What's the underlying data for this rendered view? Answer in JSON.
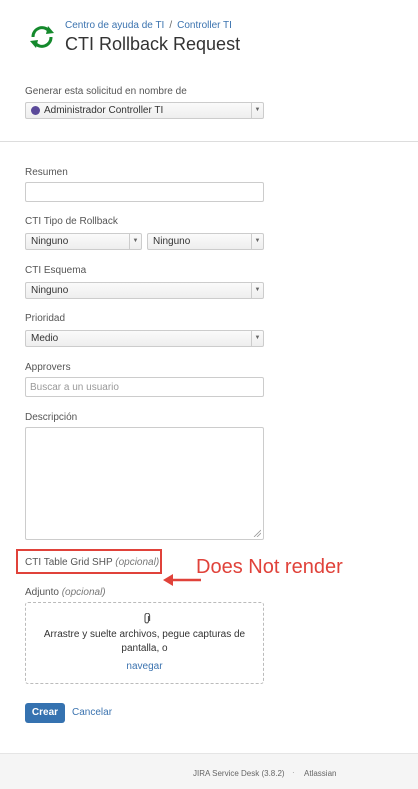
{
  "header": {
    "breadcrumb": [
      "Centro de ayuda de TI",
      "Controller TI"
    ],
    "breadcrumb_separator": "/",
    "title": "CTI Rollback Request",
    "logo_icon": "refresh-cycle-icon",
    "logo_color": "#14892c"
  },
  "on_behalf": {
    "label": "Generar esta solicitud en nombre de",
    "value": "Administrador Controller TI"
  },
  "form": {
    "resumen_label": "Resumen",
    "tipo_label": "CTI Tipo de Rollback",
    "tipo_value_1": "Ninguno",
    "tipo_value_2": "Ninguno",
    "esquema_label": "CTI Esquema",
    "esquema_value": "Ninguno",
    "prioridad_label": "Prioridad",
    "prioridad_value": "Medio",
    "approvers_label": "Approvers",
    "approvers_placeholder": "Buscar a un usuario",
    "descripcion_label": "Descripción",
    "grid_label": "CTI Table Grid SHP",
    "grid_optional": "(opcional)",
    "adjunto_label": "Adjunto",
    "adjunto_optional": "(opcional)",
    "drop_line1": "Arrastre y suelte archivos, pegue capturas de",
    "drop_line2": "pantalla, o",
    "drop_link": "navegar"
  },
  "actions": {
    "create": "Crear",
    "cancel": "Cancelar"
  },
  "annotation": {
    "text": "Does Not render",
    "color": "#e0423a"
  },
  "footer": {
    "product": "JIRA Service Desk (3.8.2)",
    "separator": "·",
    "vendor": "Atlassian"
  }
}
